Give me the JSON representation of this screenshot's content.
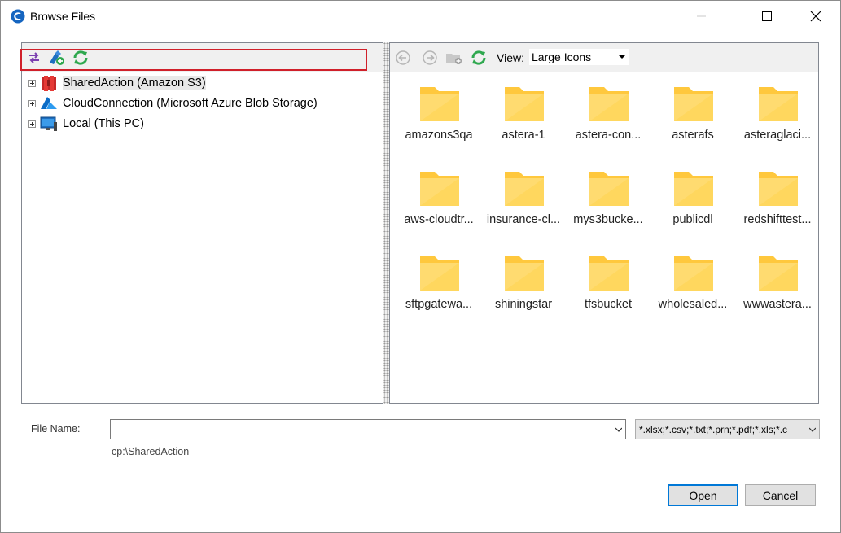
{
  "window": {
    "title": "Browse Files",
    "controls": [
      "minimize-icon",
      "maximize-icon",
      "close-icon"
    ]
  },
  "left_toolbar": {
    "icons": [
      "swap-arrows-icon",
      "add-connection-icon",
      "refresh-icon"
    ]
  },
  "tree": {
    "items": [
      {
        "label": "SharedAction (Amazon S3)",
        "icon": "amazon-s3-icon",
        "selected": true
      },
      {
        "label": "CloudConnection (Microsoft Azure Blob Storage)",
        "icon": "azure-icon",
        "highlighted": true
      },
      {
        "label": "Local (This PC)",
        "icon": "computer-icon"
      }
    ]
  },
  "right_toolbar": {
    "icons": [
      "back-icon",
      "forward-icon",
      "new-folder-icon",
      "refresh-icon"
    ],
    "view_label": "View:",
    "view_value": "Large Icons"
  },
  "folders": [
    {
      "label": "amazons3qa"
    },
    {
      "label": "astera-1"
    },
    {
      "label": "astera-con..."
    },
    {
      "label": "asterafs"
    },
    {
      "label": "asteraglaci..."
    },
    {
      "label": "aws-cloudtr..."
    },
    {
      "label": "insurance-cl..."
    },
    {
      "label": "mys3bucke..."
    },
    {
      "label": "publicdl"
    },
    {
      "label": "redshifttest..."
    },
    {
      "label": "sftpgatewa..."
    },
    {
      "label": "shiningstar"
    },
    {
      "label": "tfsbucket"
    },
    {
      "label": "wholesaled..."
    },
    {
      "label": "wwwastera..."
    }
  ],
  "bottom": {
    "file_name_label": "File Name:",
    "file_name_value": "",
    "filter_value": "*.xlsx;*.csv;*.txt;*.prn;*.pdf;*.xls;*.c",
    "current_path": "cp:\\SharedAction",
    "open_label": "Open",
    "cancel_label": "Cancel"
  },
  "colors": {
    "folder": "#ffc83d",
    "highlight_border": "#d0202a",
    "accent": "#0078d7",
    "refresh_green": "#2fa84f"
  }
}
